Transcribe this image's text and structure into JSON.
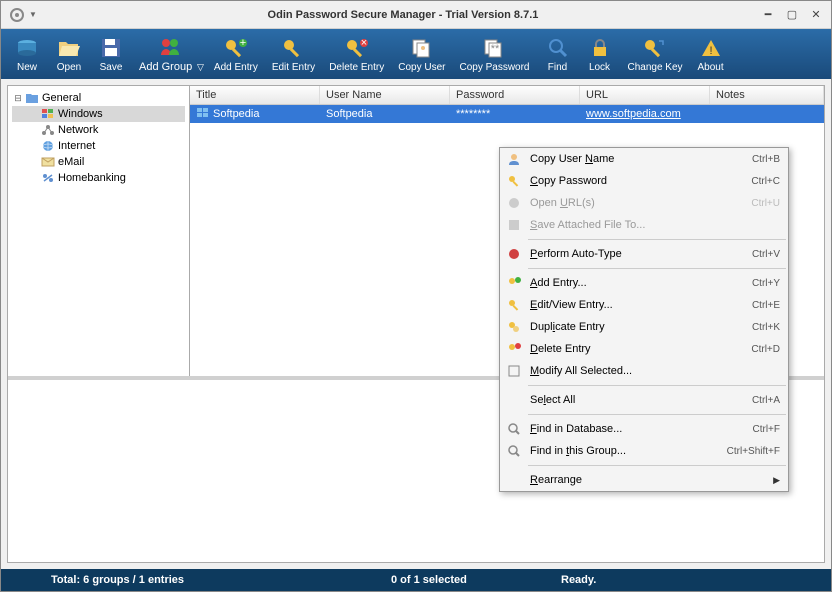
{
  "window": {
    "title": "Odin Password Secure Manager - Trial Version 8.7.1"
  },
  "toolbar": {
    "new": "New",
    "open": "Open",
    "save": "Save",
    "addgroup": "Add Group",
    "addentry": "Add Entry",
    "editentry": "Edit Entry",
    "deleteentry": "Delete Entry",
    "copyuser": "Copy User",
    "copypass": "Copy Password",
    "find": "Find",
    "lock": "Lock",
    "changekey": "Change Key",
    "about": "About"
  },
  "tree": {
    "root": "General",
    "items": [
      "Windows",
      "Network",
      "Internet",
      "eMail",
      "Homebanking"
    ]
  },
  "columns": {
    "title": "Title",
    "user": "User Name",
    "pass": "Password",
    "url": "URL",
    "notes": "Notes"
  },
  "entry": {
    "title": "Softpedia",
    "user": "Softpedia",
    "pass": "********",
    "url": "www.softpedia.com",
    "notes": ""
  },
  "status": {
    "left": "Total: 6 groups / 1 entries",
    "mid": "0 of 1 selected",
    "right": "Ready."
  },
  "menu": {
    "copyuser": "Copy User Name",
    "copyuser_sc": "Ctrl+B",
    "copypass": "Copy Password",
    "copypass_sc": "Ctrl+C",
    "openurl": "Open URL(s)",
    "openurl_sc": "Ctrl+U",
    "saveatt": "Save Attached File To...",
    "autotype": "Perform Auto-Type",
    "autotype_sc": "Ctrl+V",
    "addentry": "Add Entry...",
    "addentry_sc": "Ctrl+Y",
    "editview": "Edit/View Entry...",
    "editview_sc": "Ctrl+E",
    "duplicate": "Duplicate Entry",
    "duplicate_sc": "Ctrl+K",
    "delete": "Delete Entry",
    "delete_sc": "Ctrl+D",
    "modify": "Modify All Selected...",
    "selectall": "Select All",
    "selectall_sc": "Ctrl+A",
    "finddb": "Find in Database...",
    "finddb_sc": "Ctrl+F",
    "findgrp": "Find in this Group...",
    "findgrp_sc": "Ctrl+Shift+F",
    "rearrange": "Rearrange"
  }
}
